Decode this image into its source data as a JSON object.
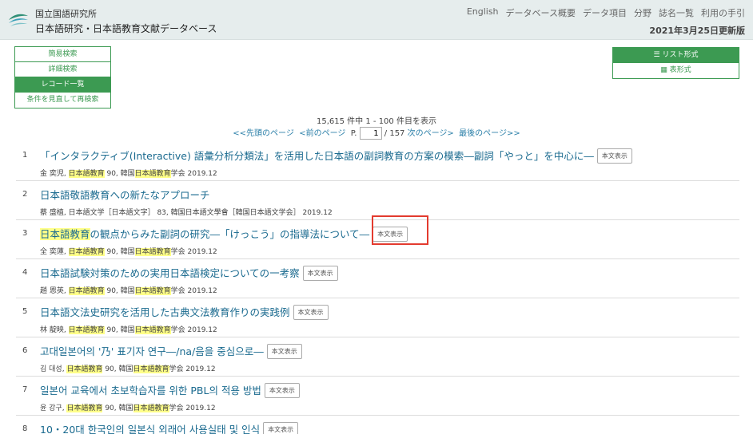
{
  "header": {
    "org": "国立国語研究所",
    "db_title": "日本語研究・日本語教育文献データベース",
    "nav": [
      "English",
      "データベース概要",
      "データ項目",
      "分野",
      "誌名一覧",
      "利用の手引"
    ],
    "update": "2021年3月25日更新版"
  },
  "search_modes": {
    "simple": "簡易検索",
    "detail": "詳細検索",
    "record_list": "レコード一覧",
    "refine": "条件を見直して再検索"
  },
  "view_modes": {
    "list": "リスト形式",
    "table": "表形式"
  },
  "results": {
    "count_text": "15,615 件中 1 - 100 件目を表示",
    "first": "<<先頭のページ",
    "prev": "<前のページ",
    "page_label": "P.",
    "page_value": "1",
    "total": "/ 157",
    "next": "次のページ>",
    "last": "最後のページ>>",
    "btn_label": "本文表示"
  },
  "items": [
    {
      "n": "1",
      "t": "「インタラクティブ(Interactive) 語彙分析分類法」を活用した日本語の副詞教育の方案の模索―副詞「やっと」を中心に―",
      "m1": "金 奕児, ",
      "mh": "日本語教育",
      "m2": " 90, 韓国",
      "mh2": "日本語教育",
      "m3": "学会 2019.12"
    },
    {
      "n": "2",
      "t": "日本語敬語教育への新たなアプローチ",
      "m1": "蔡 盛植, 日本語文学［日本語文字］ 83, 韓国日本語文學會［韓国日本語文学会］ 2019.12",
      "mh": "",
      "m2": "",
      "mh2": "",
      "m3": ""
    },
    {
      "n": "3",
      "th": "日本語教育",
      "t": "の観点からみた副詞の研究―「けっこう」の指導法について―",
      "m1": "全 奕蓮, ",
      "mh": "日本語教育",
      "m2": " 90, 韓国",
      "mh2": "日本語教育",
      "m3": "学会 2019.12"
    },
    {
      "n": "4",
      "t": "日本語試験対策のための実用日本語検定についての一考察",
      "m1": "趙 恩英, ",
      "mh": "日本語教育",
      "m2": " 90, 韓国",
      "mh2": "日本語教育",
      "m3": "学会 2019.12"
    },
    {
      "n": "5",
      "t": "日本語文法史研究を活用した古典文法教育作りの実践例",
      "m1": "林 靛映, ",
      "mh": "日本語教育",
      "m2": " 90, 韓国",
      "mh2": "日本語教育",
      "m3": "学会 2019.12"
    },
    {
      "n": "6",
      "t": "고대일본어의 '乃' 표기자 연구―/na/음을 중심으로―",
      "m1": "김 대성, ",
      "mh": "日本語教育",
      "m2": " 90, 韓国",
      "mh2": "日本語教育",
      "m3": "学会 2019.12"
    },
    {
      "n": "7",
      "t": "일본어 교육에서 초보학습자를 위한 PBL의 적용 방법",
      "m1": "윤 강구, ",
      "mh": "日本語教育",
      "m2": " 90, 韓国",
      "mh2": "日本語教育",
      "m3": "学会 2019.12"
    },
    {
      "n": "8",
      "t": "10・20대 한국인의 일본식 외래어 사용실태 및 인식",
      "m1": "",
      "mh": "",
      "m2": "",
      "mh2": "",
      "m3": ""
    }
  ]
}
